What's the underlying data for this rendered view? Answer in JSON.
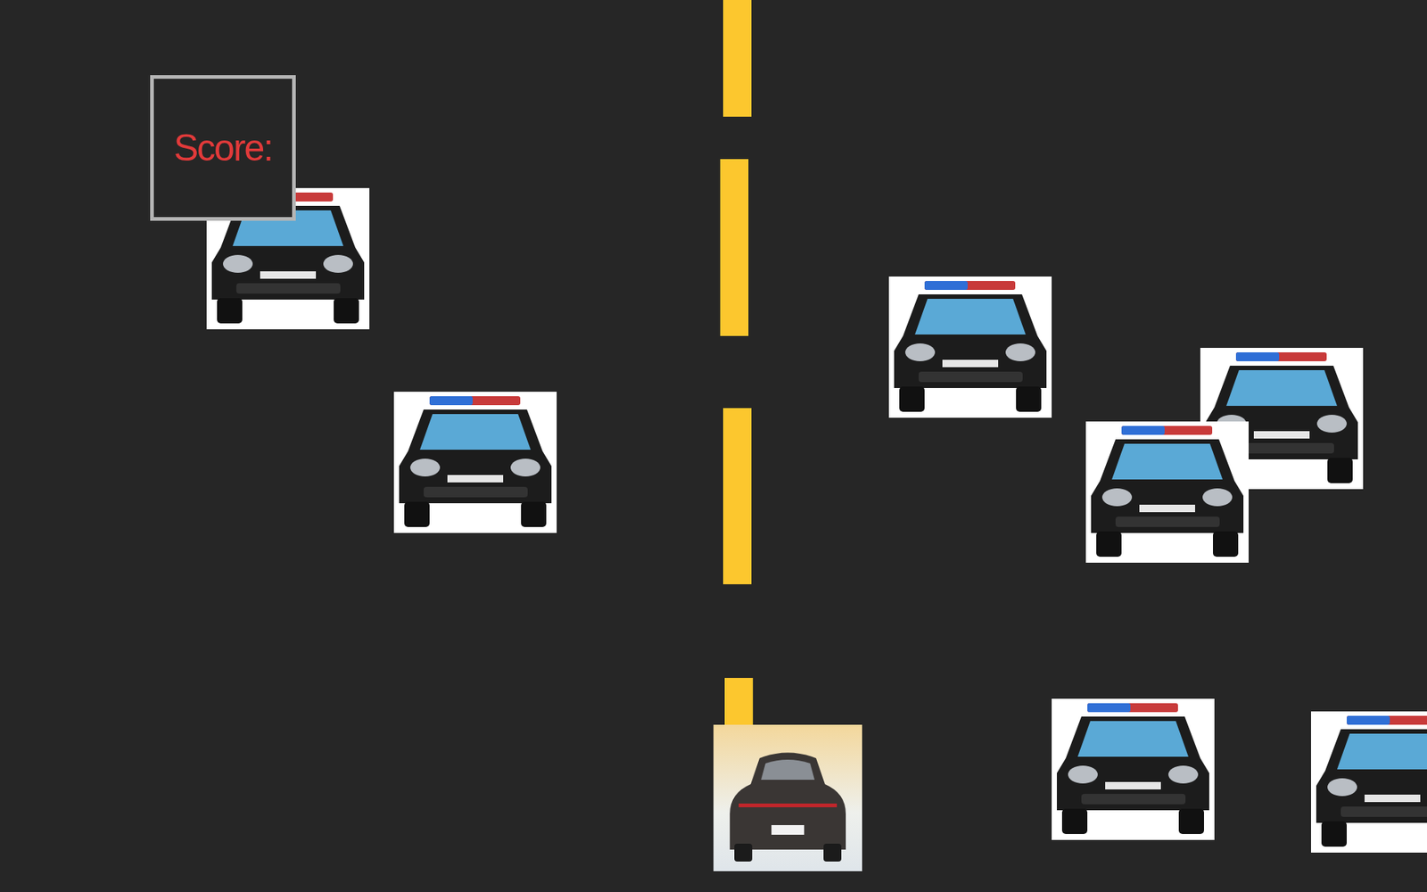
{
  "score": {
    "label": "Score:"
  },
  "vehicles": [
    {
      "kind": "police"
    },
    {
      "kind": "police"
    },
    {
      "kind": "police"
    },
    {
      "kind": "police"
    },
    {
      "kind": "police"
    },
    {
      "kind": "police"
    },
    {
      "kind": "police"
    },
    {
      "kind": "player"
    }
  ]
}
